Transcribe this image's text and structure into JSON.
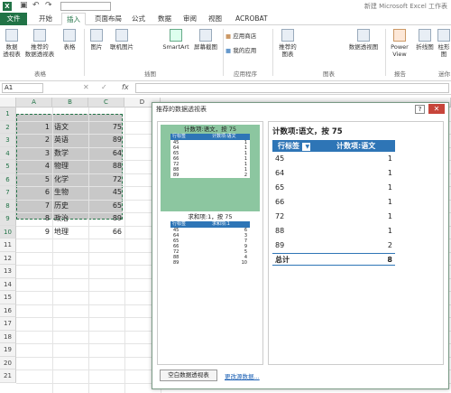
{
  "titlebar": {
    "icon_label": "X",
    "undo": "↶",
    "redo": "↷",
    "window_title": "新建 Microsoft Excel 工作表"
  },
  "tabs": [
    "文件",
    "开始",
    "插入",
    "页面布局",
    "公式",
    "数据",
    "审阅",
    "视图",
    "ACROBAT"
  ],
  "ribbon": {
    "buttons": [
      {
        "label": "数据\n透视表",
        "icon": "pivot-icon"
      },
      {
        "label": "推荐的\n数据透视表",
        "icon": "recommended-pivot-icon"
      },
      {
        "label": "表格",
        "icon": "table-icon"
      },
      {
        "label": "图片",
        "icon": "picture-icon"
      },
      {
        "label": "联机图片",
        "icon": "online-picture-icon"
      },
      {
        "label": "SmartArt",
        "icon": "smartart-icon"
      },
      {
        "label": "屏幕截图",
        "icon": "screenshot-icon"
      },
      {
        "label": "应用商店",
        "icon": "store-icon"
      },
      {
        "label": "我的应用",
        "icon": "my-apps-icon"
      },
      {
        "label": "推荐的\n图表",
        "icon": "recommended-chart-icon"
      },
      {
        "label": "数据透视图",
        "icon": "pivot-chart-icon"
      },
      {
        "label": "Power\nView",
        "icon": "power-view-icon"
      },
      {
        "label": "折线图",
        "icon": "line-chart-icon"
      },
      {
        "label": "柱形图",
        "icon": "column-chart-icon"
      }
    ],
    "groups": [
      "表格",
      "插图",
      "应用程序",
      "图表",
      "报告",
      "迷你"
    ]
  },
  "formula": {
    "namebox": "A1",
    "fx": "fx",
    "value": ""
  },
  "sheet": {
    "columns": [
      "A",
      "B",
      "C",
      "D"
    ],
    "rows": [
      "1",
      "2",
      "3",
      "4",
      "5",
      "6",
      "7",
      "8",
      "9",
      "10",
      "11",
      "12",
      "13",
      "14",
      "15",
      "16",
      "17",
      "18",
      "19",
      "20",
      "21"
    ],
    "data": [
      {
        "a": "1",
        "b": "语文",
        "c": "75"
      },
      {
        "a": "2",
        "b": "英语",
        "c": "89"
      },
      {
        "a": "3",
        "b": "数学",
        "c": "64"
      },
      {
        "a": "4",
        "b": "物理",
        "c": "88"
      },
      {
        "a": "5",
        "b": "化学",
        "c": "72"
      },
      {
        "a": "6",
        "b": "生物",
        "c": "45"
      },
      {
        "a": "7",
        "b": "历史",
        "c": "65"
      },
      {
        "a": "8",
        "b": "政治",
        "c": "89"
      },
      {
        "a": "9",
        "b": "地理",
        "c": "66"
      }
    ]
  },
  "dialog": {
    "title": "推荐的数据透视表",
    "help": "?",
    "close": "✕",
    "cards": [
      {
        "title": "计数项:语文，按 75",
        "h1": "行标签",
        "h2": "计数项:语文",
        "rows": [
          [
            "45",
            "1"
          ],
          [
            "64",
            "1"
          ],
          [
            "65",
            "1"
          ],
          [
            "66",
            "1"
          ],
          [
            "72",
            "1"
          ],
          [
            "88",
            "1"
          ],
          [
            "89",
            "2"
          ]
        ]
      },
      {
        "title": "求和项:1，按 75",
        "h1": "行标签",
        "h2": "求和项:1",
        "rows": [
          [
            "45",
            "6"
          ],
          [
            "64",
            "3"
          ],
          [
            "65",
            "7"
          ],
          [
            "66",
            "9"
          ],
          [
            "72",
            "5"
          ],
          [
            "88",
            "4"
          ],
          [
            "89",
            "10"
          ]
        ]
      }
    ],
    "preview": {
      "title": "计数项:语文，按 75",
      "h1": "行标签",
      "h2": "计数项:语文",
      "rows": [
        [
          "45",
          "1"
        ],
        [
          "64",
          "1"
        ],
        [
          "65",
          "1"
        ],
        [
          "66",
          "1"
        ],
        [
          "72",
          "1"
        ],
        [
          "88",
          "1"
        ],
        [
          "89",
          "2"
        ]
      ],
      "total_label": "总计",
      "total_value": "8"
    },
    "blank_pivot_button": "空白数据透视表",
    "change_source_link": "更改源数据..."
  },
  "colors": {
    "excel_green": "#217346",
    "pivot_blue": "#2e75b6",
    "card_selected": "#8cc6a0"
  }
}
